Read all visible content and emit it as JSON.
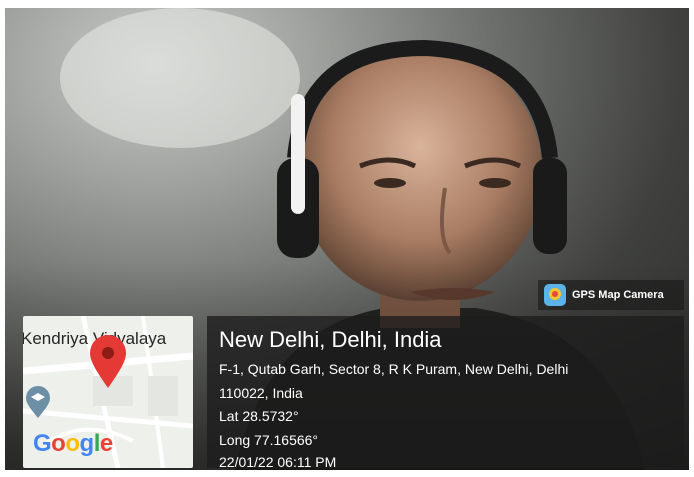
{
  "badge": {
    "label": "GPS Map Camera",
    "icon": "gps-map-camera-app-icon"
  },
  "map": {
    "place_label": "Kendriya Vidyalaya",
    "logo": "Google",
    "marker_icon": "map-pin-icon",
    "poi_icon": "school-icon"
  },
  "location": {
    "title": "New Delhi, Delhi, India",
    "address_line1": "F-1, Qutab Garh, Sector 8, R K Puram, New Delhi, Delhi",
    "address_line2": "110022, India",
    "lat": "Lat 28.5732°",
    "long": "Long 77.16566°",
    "datetime": "22/01/22 06:11 PM"
  },
  "colors": {
    "overlay": "#1c1c1c",
    "pin": "#e53935",
    "google_blue": "#4285f4",
    "google_red": "#ea4335",
    "google_yellow": "#fbbc05",
    "google_green": "#34a853"
  }
}
